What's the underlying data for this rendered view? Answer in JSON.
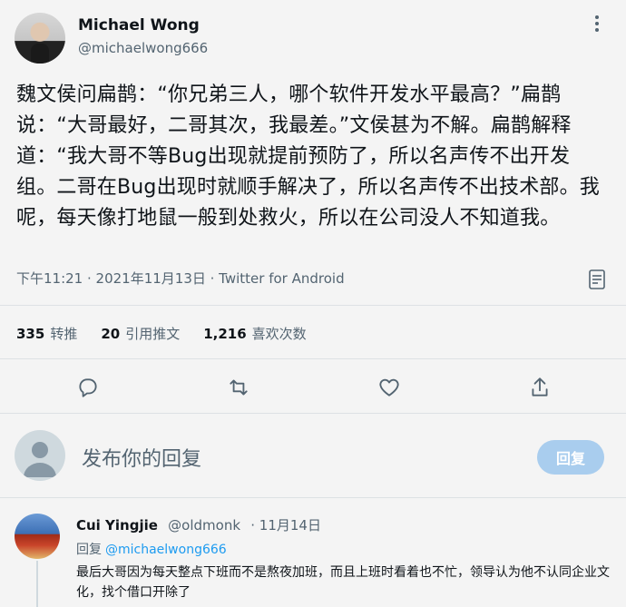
{
  "tweet": {
    "author_name": "Michael Wong",
    "author_handle": "@michaelwong666",
    "text": "魏文侯问扁鹊：“你兄弟三人，哪个软件开发水平最高？”扁鹊说：“大哥最好，二哥其次，我最差。”文侯甚为不解。扁鹊解释道：“我大哥不等Bug出现就提前预防了，所以名声传不出开发组。二哥在Bug出现时就顺手解决了，所以名声传不出技术部。我呢，每天像打地鼠一般到处救火，所以在公司没人不知道我。",
    "meta": "下午11:21 · 2021年11月13日 · Twitter for Android",
    "stats": {
      "retweets_count": "335",
      "retweets_label": "转推",
      "quotes_count": "20",
      "quotes_label": "引用推文",
      "likes_count": "1,216",
      "likes_label": "喜欢次数"
    }
  },
  "reply_box": {
    "placeholder": "发布你的回复",
    "button_label": "回复"
  },
  "comment": {
    "author_name": "Cui Yingjie",
    "author_handle": "@oldmonk",
    "date": "· 11月14日",
    "replying_label": "回复",
    "replying_to": "@michaelwong666",
    "text": "最后大哥因为每天整点下班而不是熬夜加班，而且上班时看着也不忙，领导认为他不认同企业文化，找个借口开除了"
  },
  "colors": {
    "accent": "#1d9bf0",
    "reply_button": "#a9cdee",
    "secondary_text": "#536471"
  },
  "icons": [
    "more-icon",
    "reply-icon",
    "retweet-icon",
    "like-icon",
    "share-icon",
    "analytics-icon"
  ]
}
